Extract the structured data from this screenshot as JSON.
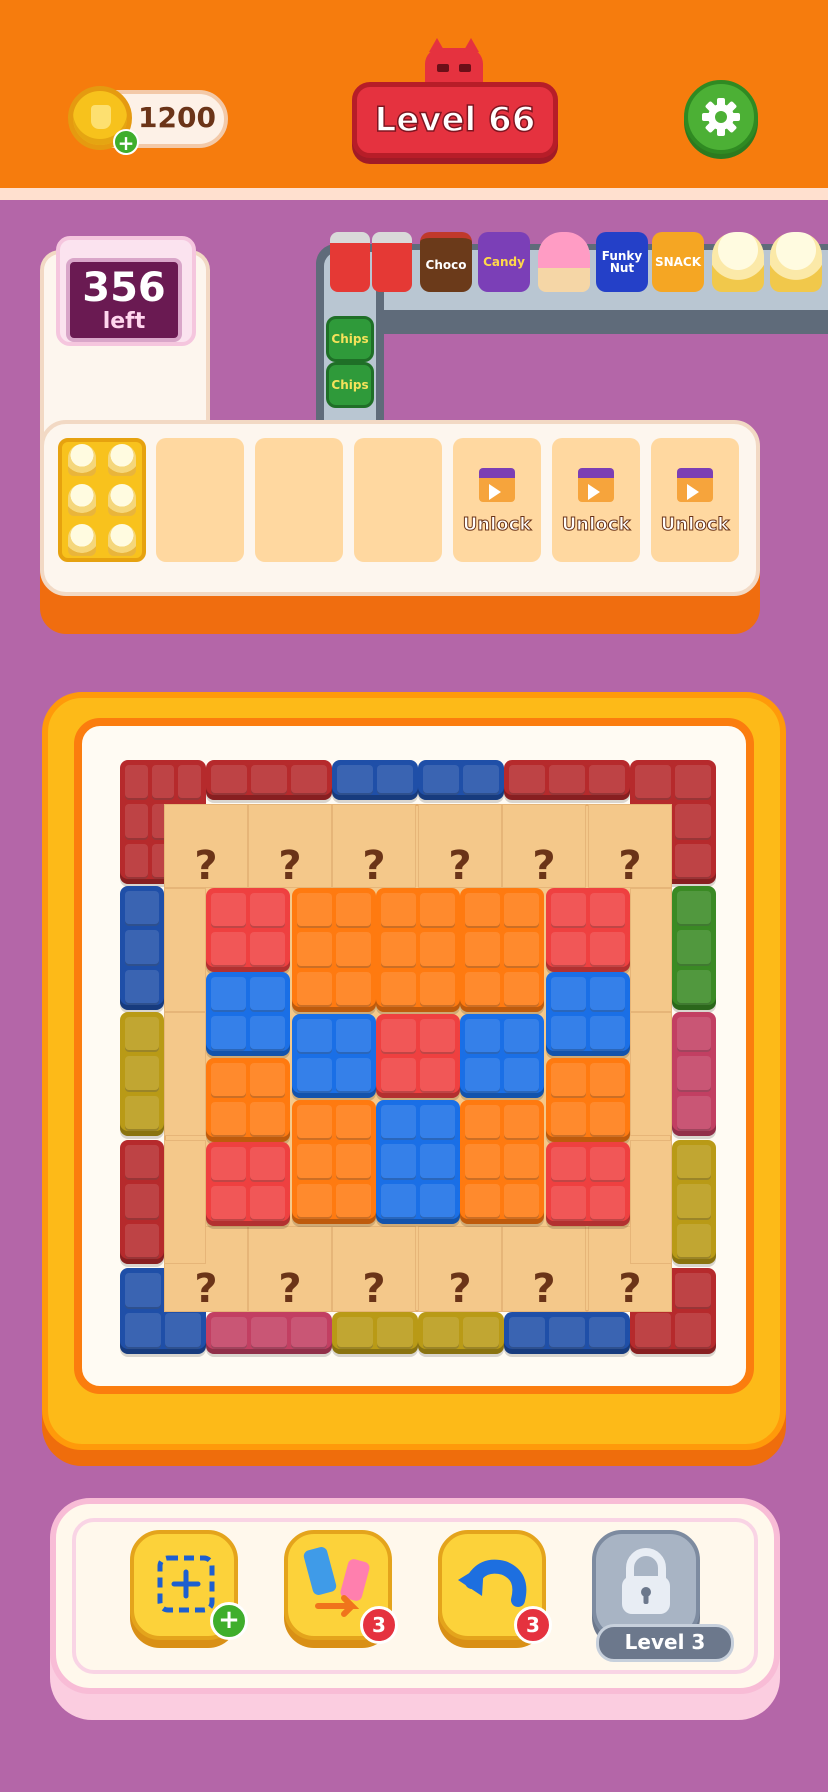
{
  "header": {
    "coins": "1200",
    "level": "Level 66"
  },
  "counter": {
    "number": "356",
    "label": "left"
  },
  "conveyor": {
    "items": [
      {
        "kind": "can",
        "label": ""
      },
      {
        "kind": "can",
        "label": ""
      },
      {
        "kind": "choco",
        "label": "Choco"
      },
      {
        "kind": "candy",
        "label": "Candy"
      },
      {
        "kind": "icecream",
        "label": ""
      },
      {
        "kind": "funky",
        "label": "Funky Nut"
      },
      {
        "kind": "snackbag",
        "label": "SNACK"
      },
      {
        "kind": "popcorn",
        "label": ""
      },
      {
        "kind": "popcorn",
        "label": ""
      }
    ],
    "vertical": [
      {
        "kind": "chips",
        "label": "Chips"
      },
      {
        "kind": "chips",
        "label": "Chips"
      }
    ]
  },
  "slots": [
    {
      "state": "filled",
      "label": ""
    },
    {
      "state": "empty",
      "label": ""
    },
    {
      "state": "empty",
      "label": ""
    },
    {
      "state": "empty",
      "label": ""
    },
    {
      "state": "locked",
      "label": "Unlock"
    },
    {
      "state": "locked",
      "label": "Unlock"
    },
    {
      "state": "locked",
      "label": "Unlock"
    }
  ],
  "board": {
    "mystery_symbol": "?",
    "colors": {
      "darkred": "#b62a2c",
      "navy": "#1f4fa8",
      "olive": "#b99a16",
      "green": "#3a8a24",
      "maroon": "#c23f62",
      "red": "#ef4040",
      "orange": "#ff7a10",
      "blue": "#1a6fe6"
    }
  },
  "tools": {
    "add_slot_badge": "+",
    "shuffle_count": "3",
    "undo_count": "3",
    "locked_label": "Level 3"
  }
}
